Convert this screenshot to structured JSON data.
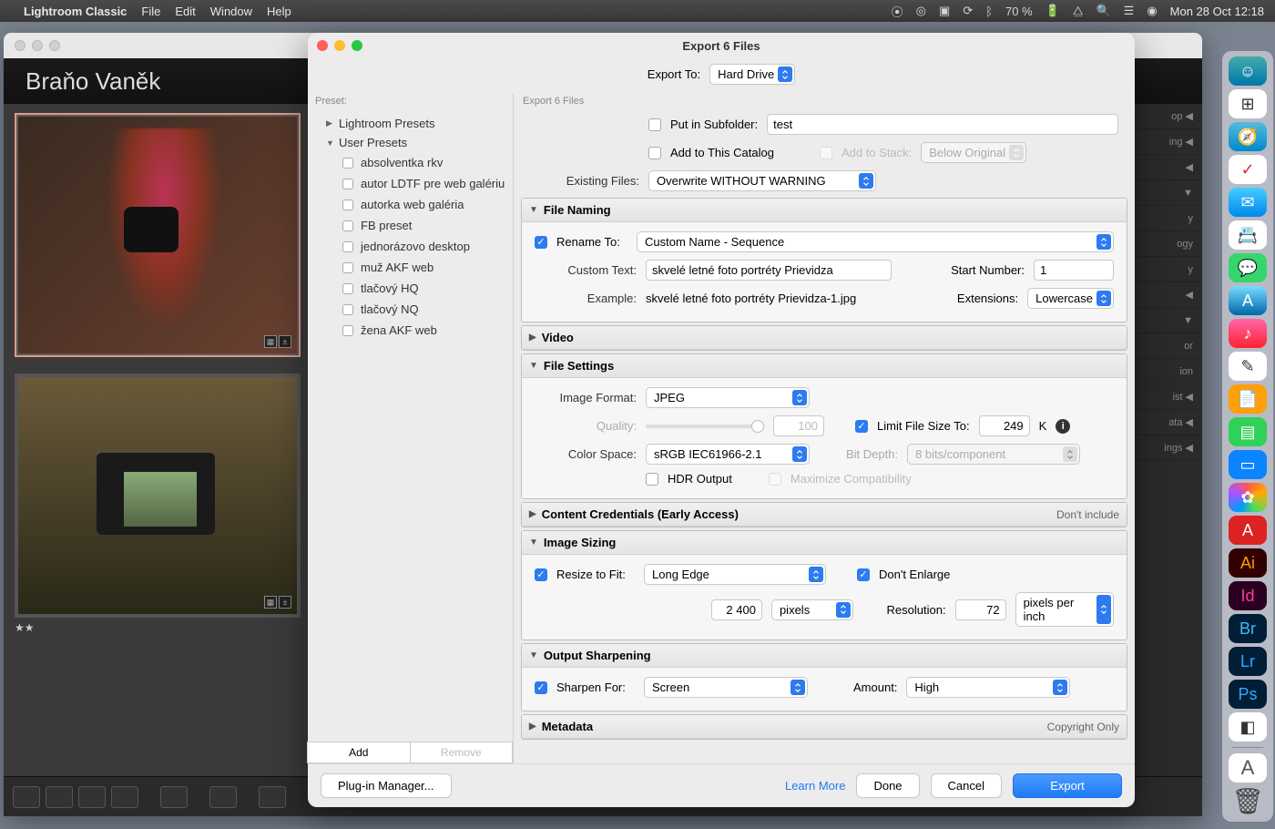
{
  "menubar": {
    "app": "Lightroom Classic",
    "items": [
      "File",
      "Edit",
      "Window",
      "Help"
    ],
    "battery": "70 %",
    "clock": "Mon 28 Oct  12:18"
  },
  "lightroom": {
    "identity": "Braňo Vaněk",
    "right_panel": [
      "op  ◀",
      "ing  ◀",
      "  ◀",
      "▼",
      "y",
      "ogy",
      "y",
      "  ◀",
      "▼",
      "or",
      "ion",
      "ist  ◀",
      "ata  ◀",
      "ings  ◀"
    ],
    "thumb2_stars": "★★"
  },
  "export": {
    "window_title": "Export 6 Files",
    "export_to_label": "Export To:",
    "export_to_value": "Hard Drive",
    "preset_header": "Preset:",
    "settings_header": "Export 6 Files",
    "preset_groups": {
      "lr": "Lightroom Presets",
      "user": "User Presets"
    },
    "user_presets": [
      "absolventka rkv",
      "autor LDTF pre web galériu",
      "autorka web galéria",
      "FB preset",
      "jednorázovo desktop",
      "muž AKF web",
      "tlačový HQ",
      "tlačový NQ",
      "žena AKF web"
    ],
    "preset_buttons": {
      "add": "Add",
      "remove": "Remove"
    },
    "location": {
      "subfolder_label": "Put in Subfolder:",
      "subfolder_value": "test",
      "add_catalog": "Add to This Catalog",
      "add_stack": "Add to Stack:",
      "stack_pos": "Below Original",
      "existing_label": "Existing Files:",
      "existing_value": "Overwrite WITHOUT WARNING"
    },
    "file_naming": {
      "title": "File Naming",
      "rename_label": "Rename To:",
      "rename_value": "Custom Name - Sequence",
      "custom_text_label": "Custom Text:",
      "custom_text_value": "skvelé letné foto portréty Prievidza",
      "start_label": "Start Number:",
      "start_value": "1",
      "example_label": "Example:",
      "example_value": "skvelé letné foto portréty Prievidza-1.jpg",
      "ext_label": "Extensions:",
      "ext_value": "Lowercase"
    },
    "video": {
      "title": "Video"
    },
    "file_settings": {
      "title": "File Settings",
      "format_label": "Image Format:",
      "format_value": "JPEG",
      "quality_label": "Quality:",
      "quality_value": "100",
      "limit_label": "Limit File Size To:",
      "limit_value": "249",
      "limit_unit": "K",
      "colorspace_label": "Color Space:",
      "colorspace_value": "sRGB IEC61966-2.1",
      "bitdepth_label": "Bit Depth:",
      "bitdepth_value": "8 bits/component",
      "hdr_label": "HDR Output",
      "maxcompat_label": "Maximize Compatibility"
    },
    "content_cred": {
      "title": "Content Credentials (Early Access)",
      "right": "Don't include"
    },
    "image_sizing": {
      "title": "Image Sizing",
      "resize_label": "Resize to Fit:",
      "resize_value": "Long Edge",
      "dont_enlarge": "Don't Enlarge",
      "dim_value": "2 400",
      "dim_unit": "pixels",
      "res_label": "Resolution:",
      "res_value": "72",
      "res_unit": "pixels per inch"
    },
    "sharpening": {
      "title": "Output Sharpening",
      "sharpen_label": "Sharpen For:",
      "sharpen_value": "Screen",
      "amount_label": "Amount:",
      "amount_value": "High"
    },
    "metadata": {
      "title": "Metadata",
      "right": "Copyright Only"
    },
    "footer": {
      "plugin": "Plug-in Manager...",
      "learn": "Learn More",
      "done": "Done",
      "cancel": "Cancel",
      "export": "Export"
    }
  }
}
